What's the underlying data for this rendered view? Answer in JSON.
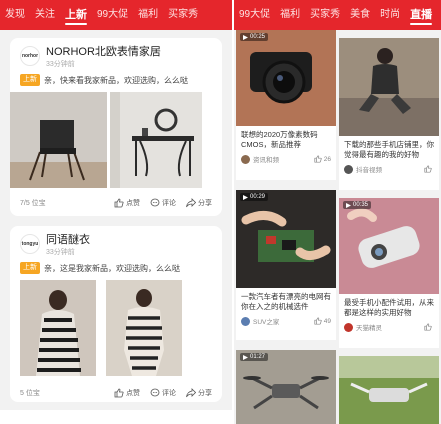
{
  "left_tabs": [
    "发现",
    "关注",
    "上新",
    "99大促",
    "福利",
    "买家秀"
  ],
  "left_active_tab": "上新",
  "right_tabs": [
    "99大促",
    "福利",
    "买家秀",
    "美食",
    "时尚",
    "直播"
  ],
  "posts": [
    {
      "shop": "NORHOR北欧表情家居",
      "logo": "norhor",
      "time": "33分钟前",
      "badge": "上新",
      "text": "亲，快来看我家新品，欢迎选购，么么哒",
      "count": "7/5 位宝",
      "like": "点赞",
      "comment": "评论",
      "share": "分享"
    },
    {
      "shop": "同语醚衣",
      "logo": "tongyu",
      "time": "33分钟前",
      "badge": "上新",
      "text": "亲，这是我家新品，欢迎选购，么么哒",
      "count": "5 位宝",
      "like": "点赞",
      "comment": "评论",
      "share": "分享"
    }
  ],
  "feed": [
    {
      "title": "联想的2020万像素数码CMOS，新品推荐",
      "author": "资讯和频",
      "likes": "26",
      "badge": "00:25"
    },
    {
      "title": "下载的那些手机店铺里，你觉得最有趣的我的好物",
      "author": "抖音视频",
      "likes": "",
      "badge": ""
    },
    {
      "title": "一款汽车者有漂亮的电网有你在入之的机械选件",
      "author": "SUV之家",
      "likes": "49",
      "badge": "00:29"
    },
    {
      "title": "最受手机小配件试用，从来都是这样的实用好物",
      "author": "天猫精灵",
      "likes": "",
      "badge": "00:35"
    },
    {
      "title": "",
      "author": "",
      "likes": "",
      "badge": "01:27"
    },
    {
      "title": "",
      "author": "",
      "likes": "",
      "badge": ""
    }
  ],
  "colors": {
    "brand_red": "#e5262c",
    "badge_orange": "#f6a623"
  }
}
